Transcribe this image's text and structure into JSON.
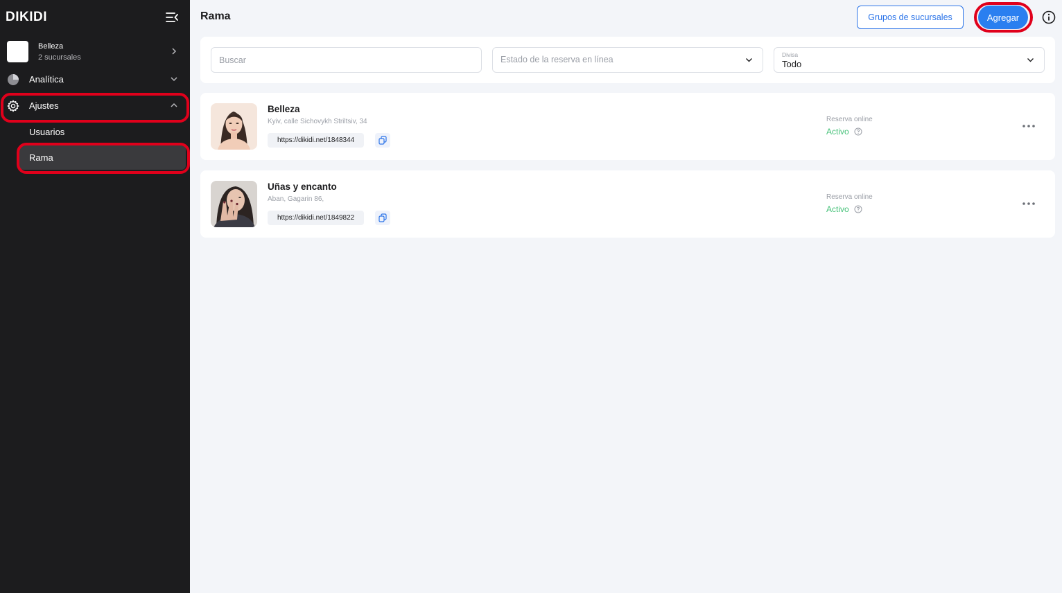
{
  "sidebar": {
    "logo": "DIKIDI",
    "company": {
      "name": "Belleza",
      "subtitle": "2 sucursales"
    },
    "nav": [
      {
        "label": "Analítica",
        "icon": "pie-chart-icon"
      },
      {
        "label": "Ajustes",
        "icon": "gear-icon"
      }
    ],
    "subnav": [
      {
        "label": "Usuarios"
      },
      {
        "label": "Rama",
        "active": true
      }
    ]
  },
  "header": {
    "title": "Rama",
    "groups_button": "Grupos de sucursales",
    "add_button": "Agregar"
  },
  "filters": {
    "search_placeholder": "Buscar",
    "status_placeholder": "Estado de la reserva en línea",
    "currency_label": "Divisa",
    "currency_value": "Todo"
  },
  "branches": [
    {
      "name": "Belleza",
      "address": "Kyiv, calle Sichovykh Striltsiv, 34",
      "link": "https://dikidi.net/1848344",
      "reservation_label": "Reserva online",
      "reservation_status": "Activo"
    },
    {
      "name": "Uñas y encanto",
      "address": "Aban, Gagarin 86,",
      "link": "https://dikidi.net/1849822",
      "reservation_label": "Reserva online",
      "reservation_status": "Activo"
    }
  ],
  "colors": {
    "sidebar_bg": "#1c1c1e",
    "accent": "#2a7ff0",
    "active_status": "#47c27a",
    "highlight": "#e0001b"
  }
}
